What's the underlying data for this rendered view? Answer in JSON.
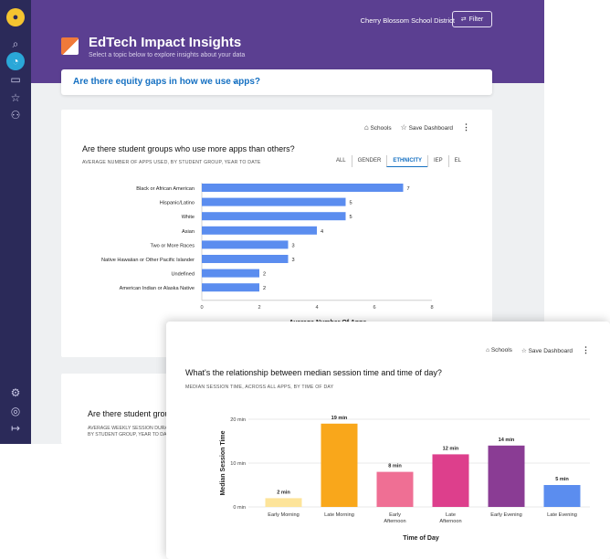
{
  "district": "Cherry Blossom School District",
  "filter_label": "Filter",
  "header": {
    "title": "EdTech Impact Insights",
    "subtitle": "Select a topic below to explore insights about your data"
  },
  "question": "Are there equity gaps in how we use apps?",
  "card_actions": {
    "schools": "Schools",
    "save": "Save Dashboard"
  },
  "card1": {
    "title": "Are there student groups who use more apps than others?",
    "subtitle": "AVERAGE NUMBER OF APPS USED, BY STUDENT GROUP, YEAR TO DATE",
    "filters": [
      "ALL",
      "GENDER",
      "ETHNICITY",
      "IEP",
      "EL"
    ],
    "active_filter": "ETHNICITY"
  },
  "card2": {
    "title": "Are there student groups w",
    "subtitle_line1": "AVERAGE WEEKLY SESSION DURATIO",
    "subtitle_line2": "BY STUDENT GROUP, YEAR TO DATE"
  },
  "overlay": {
    "title": "What's the relationship between median session time and time of day?",
    "subtitle": "MEDIAN SESSION TIME, ACROSS ALL APPS, BY TIME OF DAY"
  },
  "colors": {
    "bar_blue": "#5b8def",
    "header_purple": "#5b3f91",
    "sidebar": "#2b2a59",
    "accent": "#1570c2"
  },
  "chart_data": [
    {
      "type": "bar",
      "orientation": "horizontal",
      "categories": [
        "Black or African American",
        "Hispanic/Latino",
        "White",
        "Asian",
        "Two or More Races",
        "Native Hawaiian or Other Pacific Islander",
        "Undefined",
        "American Indian or Alaska Native"
      ],
      "values": [
        7,
        5,
        5,
        4,
        3,
        3,
        2,
        2
      ],
      "data_labels": [
        "7",
        "5",
        "5",
        "4",
        "3",
        "3",
        "2",
        "2"
      ],
      "xlabel": "Average Number Of Apps",
      "xlim": [
        0,
        8
      ],
      "xticks": [
        "0",
        "2",
        "4",
        "6",
        "8"
      ],
      "color": "#5b8def"
    },
    {
      "type": "bar",
      "categories": [
        "Early Morning",
        "Late Morning",
        "Early Afternoon",
        "Late Afternoon",
        "Early Evening",
        "Late Evening"
      ],
      "values": [
        2,
        19,
        8,
        12,
        14,
        5
      ],
      "data_labels": [
        "2 min",
        "19 min",
        "8 min",
        "12 min",
        "14 min",
        "5 min"
      ],
      "colors": [
        "#fde49a",
        "#f9a71b",
        "#ef6f94",
        "#dd3f8c",
        "#8a3c94",
        "#5b8def"
      ],
      "xlabel": "Time of Day",
      "ylabel": "Median Session Time",
      "ylim": [
        0,
        20
      ],
      "yticks": [
        "0 min",
        "10 min",
        "20 min"
      ]
    }
  ]
}
